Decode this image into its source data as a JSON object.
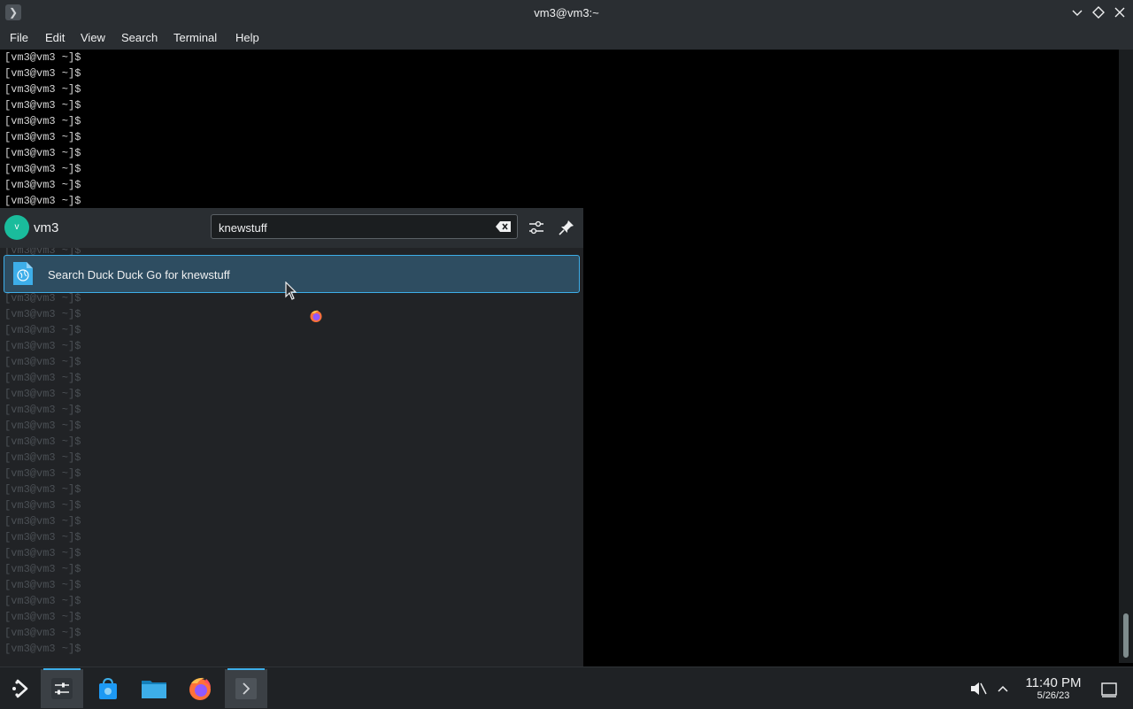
{
  "window": {
    "title": "vm3@vm3:~",
    "icon": "terminal-icon",
    "controls": [
      "minimize-icon",
      "maximize-icon",
      "close-icon"
    ]
  },
  "menu": {
    "file": "File",
    "edit": "Edit",
    "view": "View",
    "search": "Search",
    "terminal": "Terminal",
    "help": "Help"
  },
  "terminal": {
    "prompt": "[vm3@vm3 ~]$"
  },
  "launcher": {
    "avatar_letter": "v",
    "username": "vm3",
    "search": {
      "value": "knewstuff",
      "placeholder": ""
    },
    "result": {
      "label": "Search Duck Duck Go for knewstuff",
      "icon": "globe-document-icon"
    }
  },
  "taskbar": {
    "clock": {
      "time": "11:40 PM",
      "date": "5/26/23"
    },
    "items": [
      "application-launcher-icon",
      "system-settings-icon",
      "discover-store-icon",
      "file-manager-icon",
      "firefox-icon",
      "konsole-icon"
    ]
  },
  "colors": {
    "accent": "#3daee9",
    "panel": "#232629",
    "highlight": "#2e4d61"
  }
}
